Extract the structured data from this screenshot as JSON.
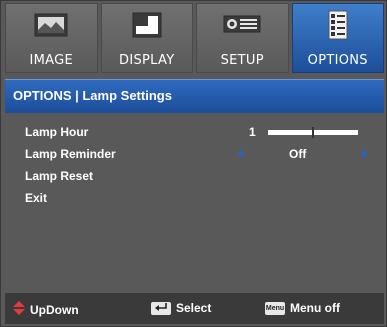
{
  "tabs": [
    {
      "label": "IMAGE",
      "icon": "image-icon"
    },
    {
      "label": "DISPLAY",
      "icon": "display-icon"
    },
    {
      "label": "SETUP",
      "icon": "setup-icon"
    },
    {
      "label": "OPTIONS",
      "icon": "options-icon",
      "active": true
    }
  ],
  "header": {
    "title": "OPTIONS | Lamp Settings"
  },
  "menu": {
    "lamp_hour": {
      "label": "Lamp Hour",
      "value": "1",
      "level": 0.5
    },
    "lamp_reminder": {
      "label": "Lamp Reminder",
      "value": "Off"
    },
    "lamp_reset": {
      "label": "Lamp Reset"
    },
    "exit": {
      "label": "Exit"
    }
  },
  "footer": {
    "updown": {
      "label": "UpDown",
      "icon": "updown-arrows-icon"
    },
    "select": {
      "label": "Select",
      "icon": "enter-key-icon"
    },
    "menu_off": {
      "label": "Menu off",
      "icon": "menu-key-icon",
      "key_text": "Menu"
    }
  },
  "colors": {
    "panel": "#595959",
    "active_tab": "#2f62b3",
    "footer": "#3a3a3a",
    "arrow_accent": "#e23b3b"
  }
}
